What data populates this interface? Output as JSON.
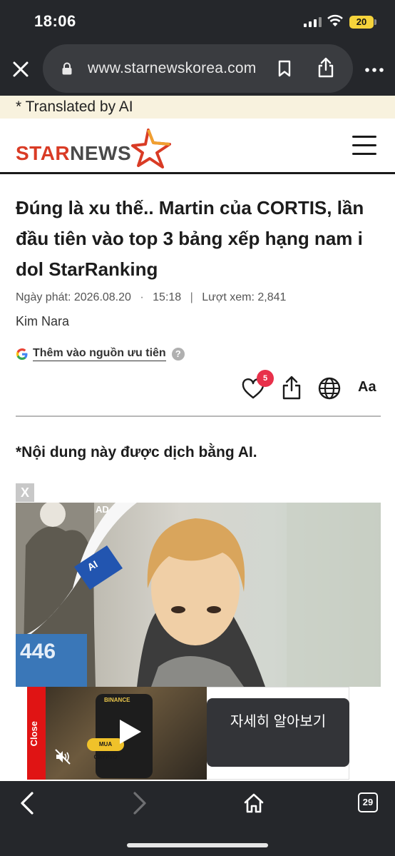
{
  "status_bar": {
    "time": "18:06",
    "battery": "20"
  },
  "browser": {
    "url": "www.starnewskorea.com",
    "open_tabs": "29",
    "icons": [
      "close-icon",
      "lock-icon",
      "bookmark-icon",
      "share-icon",
      "more-icon",
      "back-icon",
      "forward-icon",
      "home-icon",
      "tabs-icon"
    ]
  },
  "translation_banner": "* Translated by AI",
  "site": {
    "logo": {
      "part1": "STAR",
      "part2": "NEWS"
    },
    "colors": {
      "brand_red": "#d93b25",
      "brand_gray": "#4a4a4a"
    }
  },
  "article": {
    "headline": "Đúng là xu thế.. Martin của CORTIS, lần đầu tiên vào top 3 bảng xếp hạng nam i dol StarRanking",
    "date_label": "Ngày phát:",
    "date": "2026.08.20",
    "time": "15:18",
    "views_label": "Lượt xem:",
    "views": "2,841",
    "author": "Kim Nara",
    "google_preferred": "Thêm vào nguồn ưu tiên",
    "help": "?",
    "like_count": "5",
    "text_size_icon": "Aa",
    "ai_note": "*Nội dung này được dịch bằng AI."
  },
  "ad": {
    "close_x": "X",
    "label": "AD",
    "ai_badge": "AI",
    "sign_text": "446",
    "sticky": {
      "close_label": "Close",
      "brand": "BINANCE",
      "crypto_button": "MUA CRYPTO",
      "cta": "자세히 알아보기"
    }
  }
}
